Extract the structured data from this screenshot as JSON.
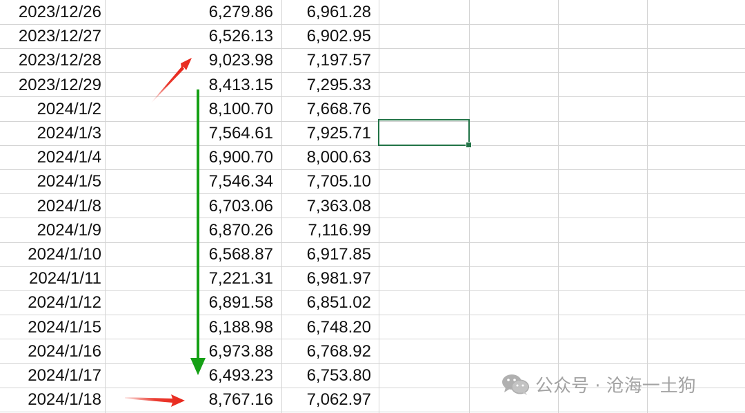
{
  "rows": [
    {
      "date": "2023/12/26",
      "v1": "6,279.86",
      "v2": "6,961.28"
    },
    {
      "date": "2023/12/27",
      "v1": "6,526.13",
      "v2": "6,902.95"
    },
    {
      "date": "2023/12/28",
      "v1": "9,023.98",
      "v2": "7,197.57"
    },
    {
      "date": "2023/12/29",
      "v1": "8,413.15",
      "v2": "7,295.33"
    },
    {
      "date": "2024/1/2",
      "v1": "8,100.70",
      "v2": "7,668.76"
    },
    {
      "date": "2024/1/3",
      "v1": "7,564.61",
      "v2": "7,925.71"
    },
    {
      "date": "2024/1/4",
      "v1": "6,900.70",
      "v2": "8,000.63"
    },
    {
      "date": "2024/1/5",
      "v1": "7,546.34",
      "v2": "7,705.10"
    },
    {
      "date": "2024/1/8",
      "v1": "6,703.06",
      "v2": "7,363.08"
    },
    {
      "date": "2024/1/9",
      "v1": "6,870.26",
      "v2": "7,116.99"
    },
    {
      "date": "2024/1/10",
      "v1": "6,568.87",
      "v2": "6,917.85"
    },
    {
      "date": "2024/1/11",
      "v1": "7,221.31",
      "v2": "6,981.97"
    },
    {
      "date": "2024/1/12",
      "v1": "6,891.58",
      "v2": "6,851.02"
    },
    {
      "date": "2024/1/15",
      "v1": "6,188.98",
      "v2": "6,748.20"
    },
    {
      "date": "2024/1/16",
      "v1": "6,973.88",
      "v2": "6,768.92"
    },
    {
      "date": "2024/1/17",
      "v1": "6,493.23",
      "v2": "6,753.80"
    },
    {
      "date": "2024/1/18",
      "v1": "8,767.16",
      "v2": "7,062.97"
    }
  ],
  "selected_cell": {
    "row_index": 5,
    "column_index": 3
  },
  "annotations": [
    {
      "kind": "arrow",
      "color": "#e8271b",
      "direction": "up-right",
      "points_to_row": "2023/12/28"
    },
    {
      "kind": "arrow",
      "color": "#15a015",
      "direction": "down",
      "from_row": "2023/12/29",
      "to_row": "2024/1/17"
    },
    {
      "kind": "arrow",
      "color": "#e8271b",
      "direction": "right",
      "points_to_row": "2024/1/18"
    }
  ],
  "watermark": {
    "icon": "wechat-icon",
    "text": "公众号 · 沧海一土狗"
  },
  "colors": {
    "grid": "#d4d4d4",
    "selection": "#217346",
    "text": "#111111",
    "watermark": "#9a9a9a"
  }
}
